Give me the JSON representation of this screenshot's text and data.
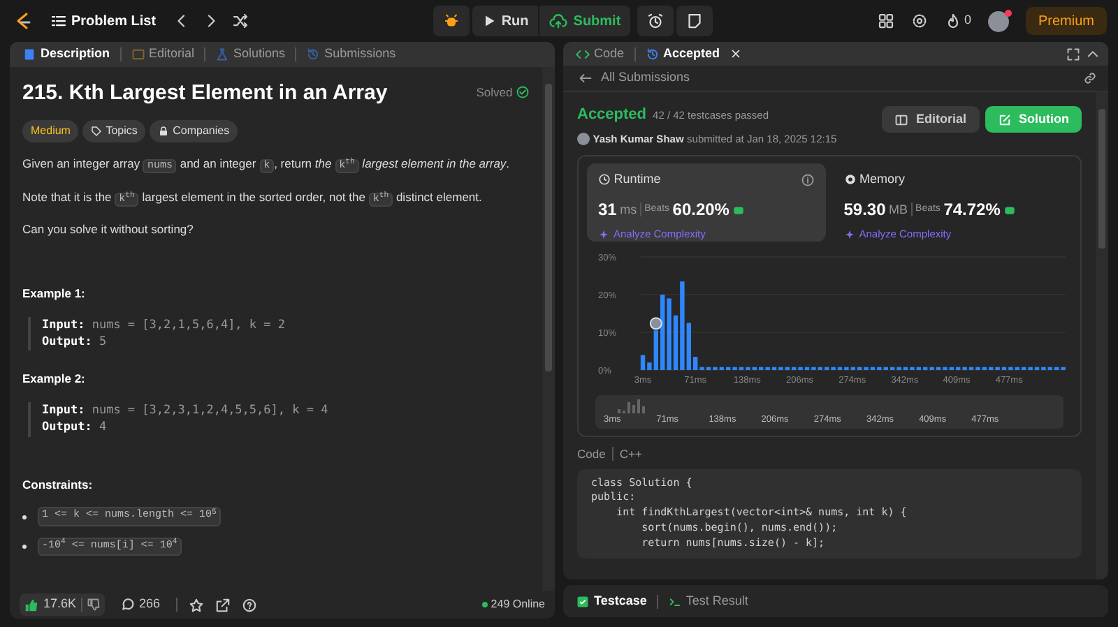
{
  "topbar": {
    "nav_title": "Problem List",
    "run": "Run",
    "submit": "Submit",
    "streak": "0",
    "premium": "Premium"
  },
  "left_tabs": [
    {
      "label": "Description",
      "selected": true
    },
    {
      "label": "Editorial",
      "selected": false
    },
    {
      "label": "Solutions",
      "selected": false
    },
    {
      "label": "Submissions",
      "selected": false
    }
  ],
  "problem": {
    "title": "215. Kth Largest Element in an Array",
    "status": "Solved",
    "difficulty": "Medium",
    "tags": [
      "Topics",
      "Companies"
    ],
    "paragraphs": [
      [
        {
          "kind": "text",
          "text": "Given an integer array "
        },
        {
          "kind": "code",
          "text": "nums"
        },
        {
          "kind": "text",
          "text": " and an integer "
        },
        {
          "kind": "code",
          "text": "k"
        },
        {
          "kind": "text",
          "text": ", return "
        },
        {
          "kind": "em",
          "text": "the "
        },
        {
          "kind": "code",
          "text": "k$^{th}$"
        },
        {
          "kind": "em",
          "text": " largest element in the array"
        },
        {
          "kind": "text",
          "text": "."
        }
      ],
      [
        {
          "kind": "text",
          "text": "Note that it is the "
        },
        {
          "kind": "code",
          "text": "k$^{th}$"
        },
        {
          "kind": "text",
          "text": " largest element in the sorted order, not the "
        },
        {
          "kind": "code",
          "text": "k$^{th}$"
        },
        {
          "kind": "text",
          "text": " distinct element."
        }
      ],
      [
        {
          "kind": "text",
          "text": "Can you solve it without sorting?"
        }
      ]
    ],
    "examples": [
      {
        "heading": "Example 1:",
        "input_label": "Input:",
        "input": "nums = [3,2,1,5,6,4], k = 2",
        "output_label": "Output:",
        "output": "5"
      },
      {
        "heading": "Example 2:",
        "input_label": "Input:",
        "input": "nums = [3,2,3,1,2,4,5,5,6], k = 4",
        "output_label": "Output:",
        "output": "4"
      }
    ],
    "constraints_heading": "Constraints:",
    "constraints": [
      "1 <= k <= nums.length <= 10$^{5}$",
      "-10$^{4}$ <= nums[i] <= 10$^{4}$"
    ]
  },
  "left_footer": {
    "likes": "17.6K",
    "comments": "266",
    "online": "249 Online"
  },
  "right_tabs": [
    {
      "label": "Code",
      "selected": false,
      "closable": false
    },
    {
      "label": "Accepted",
      "selected": true,
      "closable": true
    }
  ],
  "back_link": "All Submissions",
  "result": {
    "status": "Accepted",
    "tests": "42 / 42 testcases passed",
    "author": "Yash Kumar Shaw",
    "submitted": "submitted at Jan 18, 2025 12:15",
    "editorial": "Editorial",
    "solution": "Solution"
  },
  "metrics": [
    {
      "kind": "runtime",
      "label": "Runtime",
      "value": "31",
      "unit": "ms",
      "beats_label": "Beats",
      "beats": "60.20%",
      "analyze": "Analyze Complexity",
      "selected": true
    },
    {
      "kind": "memory",
      "label": "Memory",
      "value": "59.30",
      "unit": "MB",
      "beats_label": "Beats",
      "beats": "74.72%",
      "analyze": "Analyze Complexity",
      "selected": false
    }
  ],
  "chart_data": {
    "type": "bar",
    "ylim": [
      0,
      30
    ],
    "xlim": [
      0,
      550
    ],
    "x": [
      3,
      11.5,
      20,
      28.5,
      37,
      45.5,
      54,
      62.5,
      71,
      79.5,
      88,
      96.5,
      105,
      113.5,
      122,
      130.5,
      139,
      147.5,
      156,
      164.5,
      173,
      181.5,
      190,
      198.5,
      207,
      215.5,
      224,
      232.5,
      241,
      249.5,
      258,
      266.5,
      275,
      283.5,
      292,
      300.5,
      309,
      317.5,
      326,
      334.5,
      343,
      351.5,
      360,
      368.5,
      377,
      385.5,
      394,
      402.5,
      411,
      419.5,
      428,
      436.5,
      445,
      453.5,
      462,
      470.5,
      479,
      487.5,
      496,
      504.5,
      513,
      521.5,
      530,
      538.5,
      547
    ],
    "yticks": [
      {
        "value": 0,
        "label": "0%"
      },
      {
        "value": 10,
        "label": "10%"
      },
      {
        "value": 20,
        "label": "20%"
      },
      {
        "value": 30,
        "label": "30%"
      }
    ],
    "xticks": [
      {
        "value": 3,
        "label": "3ms"
      },
      {
        "value": 71,
        "label": "71ms"
      },
      {
        "value": 138,
        "label": "138ms"
      },
      {
        "value": 206,
        "label": "206ms"
      },
      {
        "value": 274,
        "label": "274ms"
      },
      {
        "value": 342,
        "label": "342ms"
      },
      {
        "value": 409,
        "label": "409ms"
      },
      {
        "value": 477,
        "label": "477ms"
      }
    ],
    "series": [
      {
        "color": "#2f87ff",
        "values": [
          4,
          2,
          10.5,
          20,
          19,
          14.5,
          23.5,
          12.5,
          3.5,
          0.8,
          0.8,
          0.8,
          0.8,
          0.8,
          0.8,
          0.8,
          0.8,
          0.8,
          0.8,
          0.8,
          0.8,
          0.8,
          0.8,
          0.8,
          0.8,
          0.8,
          0.8,
          0.8,
          0.8,
          0.8,
          0.8,
          0.8,
          0.8,
          0.8,
          0.8,
          0.8,
          0.8,
          0.8,
          0.8,
          0.8,
          0.8,
          0.8,
          0.8,
          0.8,
          0.8,
          0.8,
          0.8,
          0.8,
          0.8,
          0.8,
          0.8,
          0.8,
          0.8,
          0.8,
          0.8,
          0.8,
          0.8,
          0.8,
          0.8,
          0.8,
          0.8,
          0.8,
          0.8,
          0.8,
          0.8
        ]
      }
    ]
  },
  "brush_labels": [
    "3ms",
    "71ms",
    "138ms",
    "206ms",
    "274ms",
    "342ms",
    "409ms",
    "477ms"
  ],
  "code": {
    "label": "Code",
    "language": "C++",
    "lines": [
      "class Solution {",
      "public:",
      "    int findKthLargest(vector<int>& nums, int k) {",
      "        sort(nums.begin(), nums.end());",
      "        return nums[nums.size() - k];"
    ]
  },
  "bottom_tabs": [
    {
      "label": "Testcase",
      "selected": true
    },
    {
      "label": "Test Result",
      "selected": false
    }
  ]
}
